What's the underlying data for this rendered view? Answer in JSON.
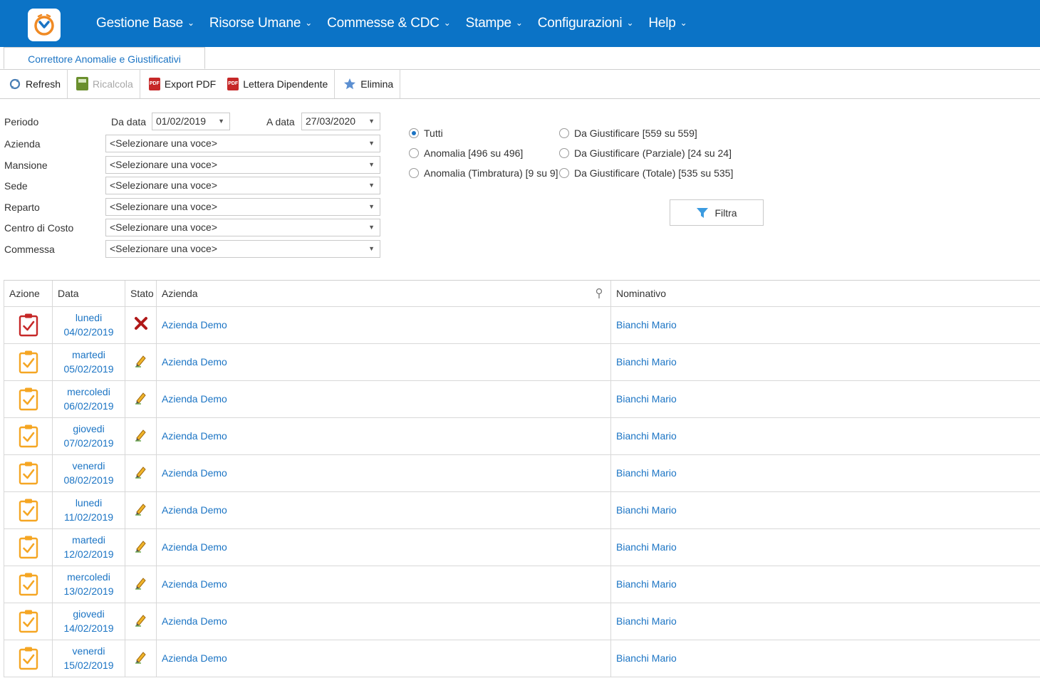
{
  "nav": {
    "menu": [
      {
        "label": "Gestione Base"
      },
      {
        "label": "Risorse Umane"
      },
      {
        "label": "Commesse & CDC"
      },
      {
        "label": "Stampe"
      },
      {
        "label": "Configurazioni"
      },
      {
        "label": "Help"
      }
    ],
    "menu_chevron": "⌄"
  },
  "tab": {
    "label": "Correttore Anomalie e Giustificativi"
  },
  "toolbar": {
    "refresh": "Refresh",
    "ricalcola": "Ricalcola",
    "export_pdf": "Export PDF",
    "lettera": "Lettera Dipendente",
    "elimina": "Elimina",
    "pdf_icon_text": "PDF"
  },
  "filters": {
    "periodo": "Periodo",
    "da_data_label": "Da data",
    "da_data_value": "01/02/2019",
    "a_data_label": "A data",
    "a_data_value": "27/03/2020",
    "azienda": "Azienda",
    "mansione": "Mansione",
    "sede": "Sede",
    "reparto": "Reparto",
    "centro_costo": "Centro di Costo",
    "commessa": "Commessa",
    "placeholder": "<Selezionare una voce>"
  },
  "radios": {
    "tutti": "Tutti",
    "anomalia": "Anomalia [496 su 496]",
    "anomalia_timbratura": "Anomalia (Timbratura) [9 su 9]",
    "da_giustificare": "Da Giustificare [559 su 559]",
    "da_giustificare_parziale": "Da Giustificare (Parziale) [24 su 24]",
    "da_giustificare_totale": "Da Giustificare (Totale) [535 su 535]",
    "selected": "tutti"
  },
  "filtra_button": "Filtra",
  "grid": {
    "headers": {
      "azione": "Azione",
      "data": "Data",
      "stato": "Stato",
      "azienda": "Azienda",
      "nominativo": "Nominativo"
    },
    "rows": [
      {
        "day": "lunedi",
        "date": "04/02/2019",
        "status": "error",
        "azienda": "Azienda Demo",
        "nominativo": "Bianchi Mario"
      },
      {
        "day": "martedi",
        "date": "05/02/2019",
        "status": "edit",
        "azienda": "Azienda Demo",
        "nominativo": "Bianchi Mario"
      },
      {
        "day": "mercoledi",
        "date": "06/02/2019",
        "status": "edit",
        "azienda": "Azienda Demo",
        "nominativo": "Bianchi Mario"
      },
      {
        "day": "giovedi",
        "date": "07/02/2019",
        "status": "edit",
        "azienda": "Azienda Demo",
        "nominativo": "Bianchi Mario"
      },
      {
        "day": "venerdi",
        "date": "08/02/2019",
        "status": "edit",
        "azienda": "Azienda Demo",
        "nominativo": "Bianchi Mario"
      },
      {
        "day": "lunedi",
        "date": "11/02/2019",
        "status": "edit",
        "azienda": "Azienda Demo",
        "nominativo": "Bianchi Mario"
      },
      {
        "day": "martedi",
        "date": "12/02/2019",
        "status": "edit",
        "azienda": "Azienda Demo",
        "nominativo": "Bianchi Mario"
      },
      {
        "day": "mercoledi",
        "date": "13/02/2019",
        "status": "edit",
        "azienda": "Azienda Demo",
        "nominativo": "Bianchi Mario"
      },
      {
        "day": "giovedi",
        "date": "14/02/2019",
        "status": "edit",
        "azienda": "Azienda Demo",
        "nominativo": "Bianchi Mario"
      },
      {
        "day": "venerdi",
        "date": "15/02/2019",
        "status": "edit",
        "azienda": "Azienda Demo",
        "nominativo": "Bianchi Mario"
      }
    ]
  },
  "colors": {
    "nav_bg": "#0b73c6",
    "link": "#1b74c4",
    "action_red": "#c62828",
    "action_orange": "#f5a623"
  }
}
